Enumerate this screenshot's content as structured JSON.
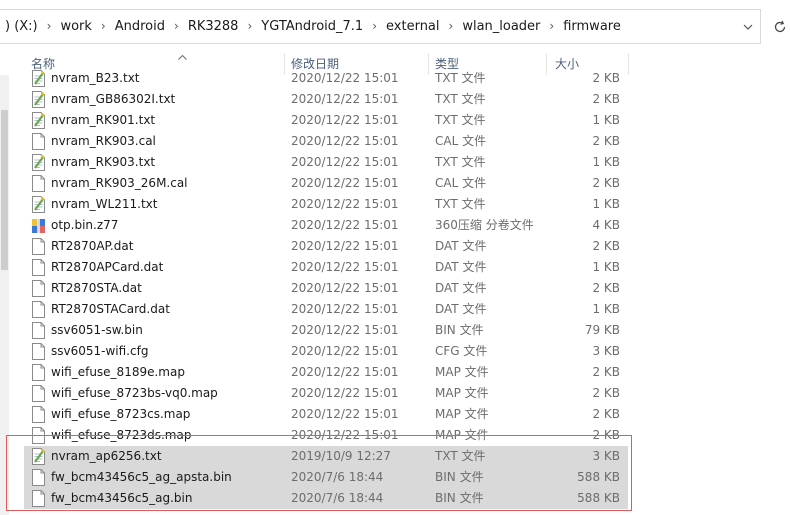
{
  "address": {
    "crumbs": [
      ") (X:)",
      "work",
      "Android",
      "RK3288",
      "YGTAndroid_7.1",
      "external",
      "wlan_loader",
      "firmware"
    ],
    "dropdown_icon": "chevron-down-icon",
    "refresh_icon": "refresh-icon"
  },
  "columns": {
    "name": "名称",
    "date": "修改日期",
    "type": "类型",
    "size": "大小"
  },
  "files": [
    {
      "name": "nvram_B23.txt",
      "date": "2020/12/22 15:01",
      "type": "TXT 文件",
      "size": "2 KB",
      "icon": "notepad-file-icon"
    },
    {
      "name": "nvram_GB86302I.txt",
      "date": "2020/12/22 15:01",
      "type": "TXT 文件",
      "size": "2 KB",
      "icon": "notepad-file-icon"
    },
    {
      "name": "nvram_RK901.txt",
      "date": "2020/12/22 15:01",
      "type": "TXT 文件",
      "size": "1 KB",
      "icon": "notepad-file-icon"
    },
    {
      "name": "nvram_RK903.cal",
      "date": "2020/12/22 15:01",
      "type": "CAL 文件",
      "size": "2 KB",
      "icon": "blank-file-icon"
    },
    {
      "name": "nvram_RK903.txt",
      "date": "2020/12/22 15:01",
      "type": "TXT 文件",
      "size": "1 KB",
      "icon": "notepad-file-icon"
    },
    {
      "name": "nvram_RK903_26M.cal",
      "date": "2020/12/22 15:01",
      "type": "CAL 文件",
      "size": "2 KB",
      "icon": "blank-file-icon"
    },
    {
      "name": "nvram_WL211.txt",
      "date": "2020/12/22 15:01",
      "type": "TXT 文件",
      "size": "1 KB",
      "icon": "notepad-file-icon"
    },
    {
      "name": "otp.bin.z77",
      "date": "2020/12/22 15:01",
      "type": "360压缩 分卷文件",
      "size": "4 KB",
      "icon": "archive-file-icon"
    },
    {
      "name": "RT2870AP.dat",
      "date": "2020/12/22 15:01",
      "type": "DAT 文件",
      "size": "2 KB",
      "icon": "blank-file-icon"
    },
    {
      "name": "RT2870APCard.dat",
      "date": "2020/12/22 15:01",
      "type": "DAT 文件",
      "size": "1 KB",
      "icon": "blank-file-icon"
    },
    {
      "name": "RT2870STA.dat",
      "date": "2020/12/22 15:01",
      "type": "DAT 文件",
      "size": "2 KB",
      "icon": "blank-file-icon"
    },
    {
      "name": "RT2870STACard.dat",
      "date": "2020/12/22 15:01",
      "type": "DAT 文件",
      "size": "1 KB",
      "icon": "blank-file-icon"
    },
    {
      "name": "ssv6051-sw.bin",
      "date": "2020/12/22 15:01",
      "type": "BIN 文件",
      "size": "79 KB",
      "icon": "blank-file-icon"
    },
    {
      "name": "ssv6051-wifi.cfg",
      "date": "2020/12/22 15:01",
      "type": "CFG 文件",
      "size": "3 KB",
      "icon": "blank-file-icon"
    },
    {
      "name": "wifi_efuse_8189e.map",
      "date": "2020/12/22 15:01",
      "type": "MAP 文件",
      "size": "2 KB",
      "icon": "blank-file-icon"
    },
    {
      "name": "wifi_efuse_8723bs-vq0.map",
      "date": "2020/12/22 15:01",
      "type": "MAP 文件",
      "size": "2 KB",
      "icon": "blank-file-icon"
    },
    {
      "name": "wifi_efuse_8723cs.map",
      "date": "2020/12/22 15:01",
      "type": "MAP 文件",
      "size": "2 KB",
      "icon": "blank-file-icon"
    },
    {
      "name": "wifi_efuse_8723ds.map",
      "date": "2020/12/22 15:01",
      "type": "MAP 文件",
      "size": "2 KB",
      "icon": "blank-file-icon"
    },
    {
      "name": "nvram_ap6256.txt",
      "date": "2019/10/9 12:27",
      "type": "TXT 文件",
      "size": "3 KB",
      "icon": "notepad-file-icon",
      "selected": true
    },
    {
      "name": "fw_bcm43456c5_ag_apsta.bin",
      "date": "2020/7/6 18:44",
      "type": "BIN 文件",
      "size": "588 KB",
      "icon": "blank-file-icon",
      "selected": true
    },
    {
      "name": "fw_bcm43456c5_ag.bin",
      "date": "2020/7/6 18:44",
      "type": "BIN 文件",
      "size": "588 KB",
      "icon": "blank-file-icon",
      "selected": true
    }
  ],
  "colors": {
    "selection": "#d9d9d9",
    "highlight_box": "#e05a5a",
    "header_text": "#4c607a"
  }
}
